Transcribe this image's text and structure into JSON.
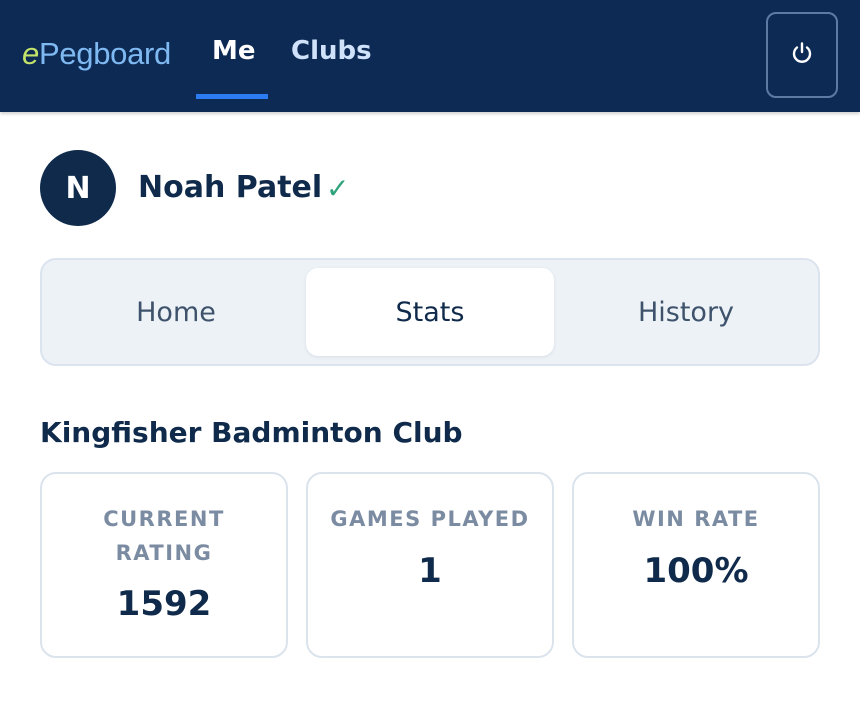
{
  "app": {
    "logo_prefix": "e",
    "logo_rest": "Pegboard"
  },
  "nav": {
    "tabs": [
      {
        "label": "Me",
        "active": true
      },
      {
        "label": "Clubs",
        "active": false
      }
    ],
    "logout_icon": "power-icon"
  },
  "profile": {
    "initial": "N",
    "name": "Noah Patel",
    "verified_mark": "✓"
  },
  "view_tabs": {
    "tabs": [
      {
        "label": "Home",
        "active": false
      },
      {
        "label": "Stats",
        "active": true
      },
      {
        "label": "History",
        "active": false
      }
    ]
  },
  "club": {
    "name": "Kingfisher Badminton Club",
    "stats": [
      {
        "label": "CURRENT RATING",
        "value": "1592"
      },
      {
        "label": "GAMES PLAYED",
        "value": "1"
      },
      {
        "label": "WIN RATE",
        "value": "100%"
      }
    ]
  },
  "colors": {
    "header_bg": "#0d2a54",
    "accent": "#2a7cf0",
    "text_primary": "#0f2a4a",
    "verified": "#2fa37a",
    "logo_e": "#c3e36a",
    "logo_text": "#7fb9f2"
  }
}
